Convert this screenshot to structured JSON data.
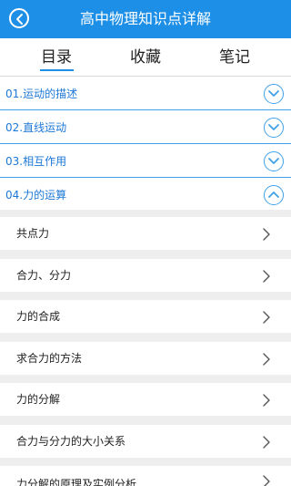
{
  "header": {
    "title": "高中物理知识点详解"
  },
  "tabs": [
    {
      "label": "目录",
      "active": true
    },
    {
      "label": "收藏",
      "active": false
    },
    {
      "label": "笔记",
      "active": false
    }
  ],
  "chapters": [
    {
      "label": "01.运动的描述",
      "expanded": false
    },
    {
      "label": "02.直线运动",
      "expanded": false
    },
    {
      "label": "03.相互作用",
      "expanded": false
    },
    {
      "label": "04.力的运算",
      "expanded": true
    }
  ],
  "subitems": [
    {
      "label": "共点力"
    },
    {
      "label": "合力、分力"
    },
    {
      "label": "力的合成"
    },
    {
      "label": "求合力的方法"
    },
    {
      "label": "力的分解"
    },
    {
      "label": "合力与分力的大小关系"
    },
    {
      "label": "力分解的原理及实例分析"
    }
  ],
  "colors": {
    "accent": "#1e8fe6",
    "chapter_text": "#1e78d6",
    "divider": "#3fa0e8",
    "list_bg": "#eeeeee"
  }
}
